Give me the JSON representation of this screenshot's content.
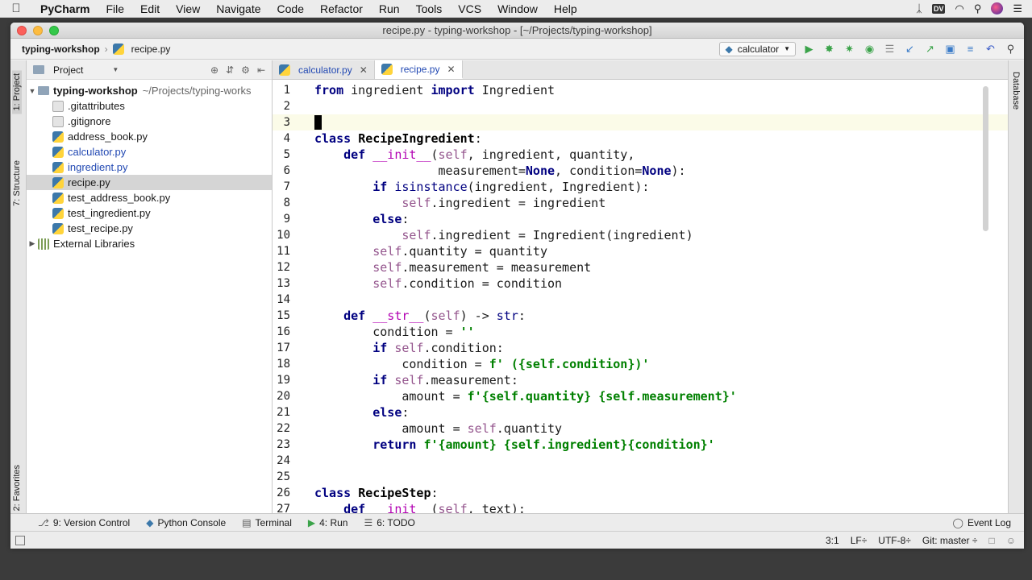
{
  "menubar": {
    "app": "PyCharm",
    "items": [
      "File",
      "Edit",
      "View",
      "Navigate",
      "Code",
      "Refactor",
      "Run",
      "Tools",
      "VCS",
      "Window",
      "Help"
    ],
    "dv_badge": "DV"
  },
  "window": {
    "title": "recipe.py - typing-workshop - [~/Projects/typing-workshop]"
  },
  "navbar": {
    "project": "typing-workshop",
    "file": "recipe.py",
    "run_config": "calculator"
  },
  "project_panel": {
    "label": "Project",
    "root_name": "typing-workshop",
    "root_path": "~/Projects/typing-works",
    "files": [
      {
        "name": ".gitattributes",
        "type": "text"
      },
      {
        "name": ".gitignore",
        "type": "text"
      },
      {
        "name": "address_book.py",
        "type": "py"
      },
      {
        "name": "calculator.py",
        "type": "py"
      },
      {
        "name": "ingredient.py",
        "type": "py"
      },
      {
        "name": "recipe.py",
        "type": "py"
      },
      {
        "name": "test_address_book.py",
        "type": "py"
      },
      {
        "name": "test_ingredient.py",
        "type": "py"
      },
      {
        "name": "test_recipe.py",
        "type": "py"
      }
    ],
    "external": "External Libraries"
  },
  "side_tabs": {
    "project": "1: Project",
    "structure": "7: Structure",
    "favorites": "2: Favorites",
    "database": "Database"
  },
  "tabs": [
    {
      "label": "calculator.py"
    },
    {
      "label": "recipe.py"
    }
  ],
  "code_lines": [
    "from ingredient import Ingredient",
    "",
    "",
    "class RecipeIngredient:",
    "    def __init__(self, ingredient, quantity,",
    "                 measurement=None, condition=None):",
    "        if isinstance(ingredient, Ingredient):",
    "            self.ingredient = ingredient",
    "        else:",
    "            self.ingredient = Ingredient(ingredient)",
    "        self.quantity = quantity",
    "        self.measurement = measurement",
    "        self.condition = condition",
    "",
    "    def __str__(self) -> str:",
    "        condition = ''",
    "        if self.condition:",
    "            condition = f' ({self.condition})'",
    "        if self.measurement:",
    "            amount = f'{self.quantity} {self.measurement}'",
    "        else:",
    "            amount = self.quantity",
    "        return f'{amount} {self.ingredient}{condition}'",
    "",
    "",
    "class RecipeStep:",
    "    def __init__(self, text):"
  ],
  "bottom_tabs": {
    "vcs": "9: Version Control",
    "console": "Python Console",
    "terminal": "Terminal",
    "run": "4: Run",
    "todo": "6: TODO",
    "event_log": "Event Log"
  },
  "status": {
    "position": "3:1",
    "line_sep": "LF÷",
    "encoding": "UTF-8÷",
    "git": "Git: master ÷"
  }
}
